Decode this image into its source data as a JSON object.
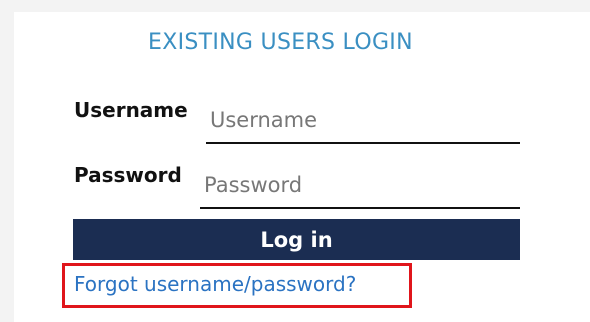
{
  "login": {
    "title": "EXISTING USERS LOGIN",
    "username_label": "Username",
    "username_placeholder": "Username",
    "password_label": "Password",
    "password_placeholder": "Password",
    "login_button": "Log in",
    "forgot_link": "Forgot username/password?"
  },
  "colors": {
    "title": "#3a8fc2",
    "button_bg": "#1b2d52",
    "link": "#2b73c2",
    "highlight_border": "#e0151b"
  }
}
